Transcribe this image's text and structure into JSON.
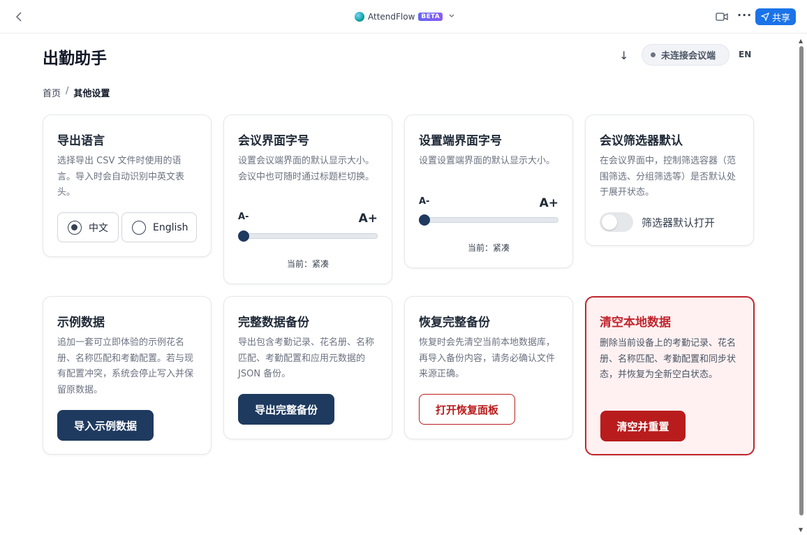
{
  "topbar": {
    "app_name": "AttendFlow",
    "beta_badge": "BETA",
    "share_label": "共享",
    "more_label": "···"
  },
  "header": {
    "title": "出勤助手",
    "download_glyph": "↓",
    "connection_status": "未连接会议端",
    "language_toggle": "EN"
  },
  "breadcrumb": {
    "home": "首页",
    "separator": "/",
    "current": "其他设置"
  },
  "cards": {
    "export_language": {
      "title": "导出语言",
      "description": "选择导出 CSV 文件时使用的语言。导入时会自动识别中英文表头。",
      "options": [
        "中文",
        "English"
      ],
      "selected": "中文"
    },
    "meeting_font": {
      "title": "会议界面字号",
      "description": "设置会议端界面的默认显示大小。会议中也可随时通过标题栏切换。",
      "min_label": "A-",
      "max_label": "A+",
      "level": 0,
      "current_label": "当前：紧凑"
    },
    "settings_font": {
      "title": "设置端界面字号",
      "description": "设置设置端界面的默认显示大小。",
      "min_label": "A-",
      "max_label": "A+",
      "level": 0,
      "current_label": "当前：紧凑"
    },
    "filter_default": {
      "title": "会议筛选器默认",
      "description": "在会议界面中，控制筛选容器（范围筛选、分组筛选等）是否默认处于展开状态。",
      "toggle_label": "筛选器默认打开",
      "enabled": false
    },
    "sample_data": {
      "title": "示例数据",
      "description": "追加一套可立即体验的示例花名册、名称匹配和考勤配置。若与现有配置冲突，系统会停止写入并保留原数据。",
      "button": "导入示例数据"
    },
    "full_backup": {
      "title": "完整数据备份",
      "description": "导出包含考勤记录、花名册、名称匹配、考勤配置和应用元数据的 JSON 备份。",
      "button": "导出完整备份"
    },
    "restore_backup": {
      "title": "恢复完整备份",
      "description": "恢复时会先清空当前本地数据库，再导入备份内容，请务必确认文件来源正确。",
      "button": "打开恢复面板"
    },
    "clear_data": {
      "title": "清空本地数据",
      "description": "删除当前设备上的考勤记录、花名册、名称匹配、考勤配置和同步状态，并恢复为全新空白状态。",
      "button": "清空并重置"
    }
  },
  "colors": {
    "accent_navy": "#1e3a5f",
    "danger_red": "#b91c1c",
    "share_blue": "#1a73e8"
  }
}
